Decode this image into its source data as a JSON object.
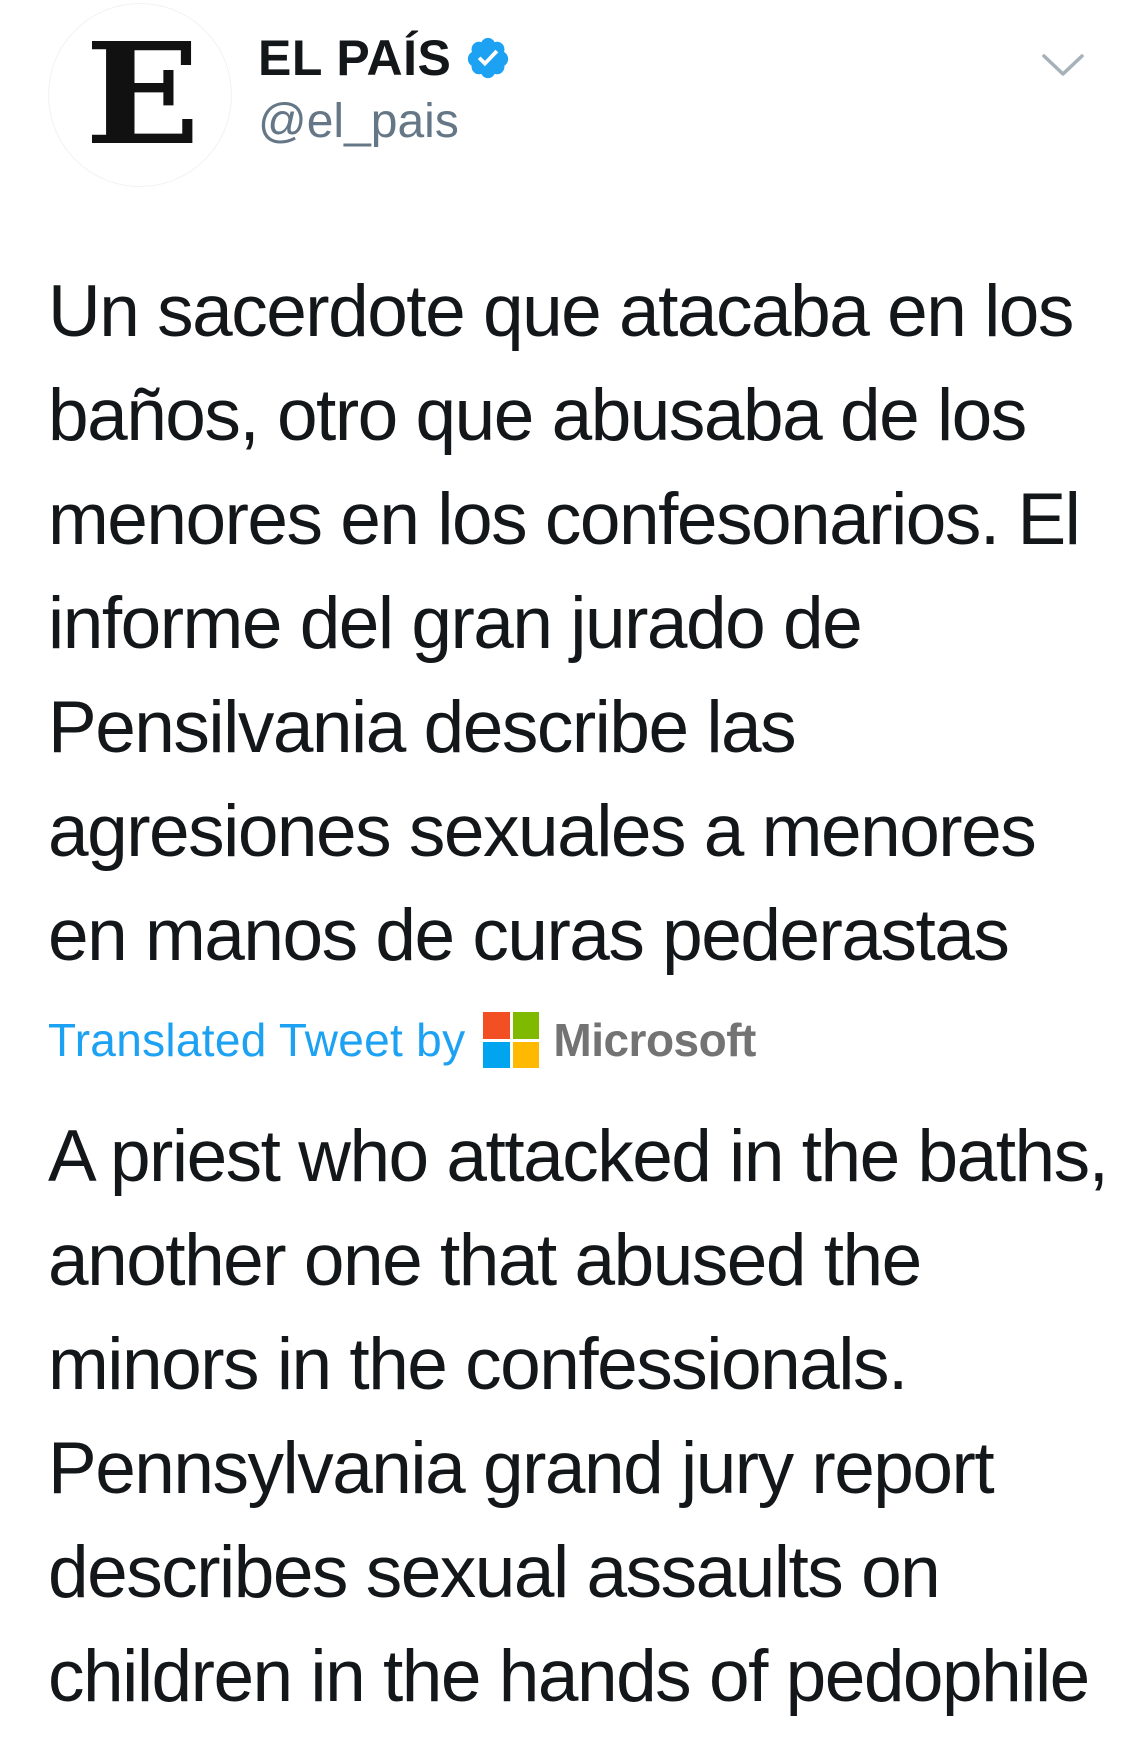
{
  "account": {
    "avatar_letter": "E",
    "display_name": "EL PAÍS",
    "handle": "@el_pais",
    "verified_icon": "verified-badge",
    "verified_color": "#1da1f2"
  },
  "menu_icon": "chevron-down-icon",
  "tweet": {
    "original_text": "Un sacerdote que atacaba en los baños, otro que abusaba de los menores en los confesonarios. El informe del gran jurado de Pensilvania describe las agresiones sexuales a menores en manos de curas pederastas",
    "translated_label": "Translated Tweet by",
    "translator_brand": "Microsoft",
    "translated_text": "A priest who attacked in the baths, another one that abused the minors in the confessionals. Pennsylvania grand jury report describes sexual assaults on children in the hands of pedophile"
  },
  "colors": {
    "link_blue": "#1da1f2",
    "ms_red": "#f25022",
    "ms_green": "#7fba00",
    "ms_blue": "#00a4ef",
    "ms_yellow": "#ffb900"
  }
}
